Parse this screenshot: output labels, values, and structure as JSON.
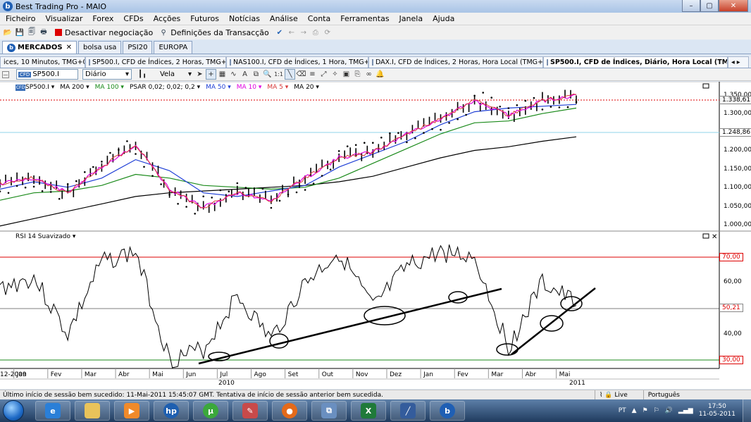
{
  "window": {
    "title": "Best Trading Pro - MAIO",
    "app_icon": "b"
  },
  "window_buttons": {
    "minimize": "–",
    "maximize": "▢",
    "close": "✕"
  },
  "menu": [
    "Ficheiro",
    "Visualizar",
    "Forex",
    "CFDs",
    "Acções",
    "Futuros",
    "Notícias",
    "Análise",
    "Conta",
    "Ferramentas",
    "Janela",
    "Ajuda"
  ],
  "toolbar": {
    "deactivate_label": "Desactivar negociação",
    "settings_label": "Definições da Transacção"
  },
  "market_tabs": [
    {
      "label": "MERCADOS",
      "active": true
    },
    {
      "label": "bolsa usa",
      "active": false
    },
    {
      "label": "PSI20",
      "active": false
    },
    {
      "label": "EUROPA",
      "active": false
    }
  ],
  "chart_tabs": [
    {
      "label": "ices, 10 Minutos, TMG+0",
      "active": false
    },
    {
      "label": "SP500.I, CFD de Índices, 2 Horas, TMG+0",
      "active": false
    },
    {
      "label": "NAS100.I, CFD de Índices, 1 Hora, TMG+0",
      "active": false
    },
    {
      "label": "DAX.I, CFD de Índices, 2 Horas, Hora Local (TMG+0)",
      "active": false
    },
    {
      "label": "SP500.I, CFD de Índices, Diário, Hora Local (TMG+0)",
      "active": true
    }
  ],
  "chart_toolbar": {
    "symbol": "SP500.I",
    "symbol_tag": "CFD",
    "period": "Diário",
    "chart_type": "Vela"
  },
  "indicators": [
    "SP500.I",
    "MA 200",
    "MA 100",
    "PSAR 0,02; 0,02; 0,2",
    "MA 50",
    "MA 10",
    "MA 5",
    "MA 20"
  ],
  "indicator_colors": {
    "MA 200": "#000000",
    "MA 100": "#1a8a1a",
    "MA 50": "#1f3fd6",
    "MA 10": "#e000e0",
    "MA 5": "#d83a3a",
    "MA 20": "#000000",
    "price": "#000000",
    "psar": "#000000"
  },
  "rsi_label": "RSI 14 Suavizado",
  "price_axis": {
    "ticks": [
      "1.350,00",
      "1.300,00",
      "1.250,00",
      "1.200,00",
      "1.150,00",
      "1.100,00",
      "1.050,00",
      "1.000,00"
    ],
    "current_price": "1.338,61",
    "cursor_price": "1.248,86"
  },
  "rsi_axis": {
    "ticks": [
      "60,00",
      "40,00"
    ],
    "overbought": "70,00",
    "oversold": "30,00",
    "current_value": "50,21"
  },
  "time_axis": {
    "start_label": "12-2009",
    "months": [
      "Jan",
      "Fev",
      "Mar",
      "Abr",
      "Mai",
      "Jun",
      "Jul",
      "Ago",
      "Set",
      "Out",
      "Nov",
      "Dez",
      "Jan",
      "Fev",
      "Mar",
      "Abr",
      "Mai"
    ],
    "years": [
      "2010",
      "2011"
    ]
  },
  "status": {
    "message": "Último início de sessão bem sucedido: 11-Mai-2011 15:45:07 GMT. Tentativa de início de sessão anterior bem sucedida.",
    "connection": "Live",
    "language": "Português"
  },
  "taskbar": {
    "apps": [
      "ie-icon",
      "explorer-icon",
      "media-player-icon",
      "hp-icon",
      "utorrent-icon",
      "paint-icon",
      "firefox-icon",
      "network-icon",
      "excel-icon",
      "chart-icon",
      "best-trading-icon"
    ],
    "locale": "PT",
    "time": "17:50",
    "date": "11-05-2011"
  },
  "chart_data": {
    "type": "line",
    "x": [
      "Dez 2009",
      "Jan 2010",
      "Fev 2010",
      "Mar 2010",
      "Abr 2010",
      "Mai 2010",
      "Jun 2010",
      "Jul 2010",
      "Ago 2010",
      "Set 2010",
      "Out 2010",
      "Nov 2010",
      "Dez 2010",
      "Jan 2011",
      "Fev 2011",
      "Mar 2011",
      "Abr 2011",
      "Mai 2011"
    ],
    "series": [
      {
        "name": "SP500.I",
        "values": [
          1105,
          1120,
          1080,
          1150,
          1210,
          1090,
          1040,
          1080,
          1060,
          1120,
          1175,
          1190,
          1240,
          1280,
          1330,
          1290,
          1330,
          1345
        ]
      },
      {
        "name": "MA 200",
        "values": [
          990,
          1010,
          1030,
          1050,
          1070,
          1080,
          1085,
          1090,
          1095,
          1100,
          1110,
          1125,
          1150,
          1175,
          1195,
          1205,
          1220,
          1232
        ]
      },
      {
        "name": "MA 100",
        "values": [
          1060,
          1080,
          1085,
          1100,
          1130,
          1120,
          1100,
          1095,
          1090,
          1095,
          1120,
          1160,
          1200,
          1240,
          1270,
          1275,
          1295,
          1310
        ]
      },
      {
        "name": "MA 50",
        "values": [
          1090,
          1110,
          1095,
          1120,
          1170,
          1140,
          1080,
          1070,
          1085,
          1100,
          1150,
          1185,
          1220,
          1265,
          1300,
          1310,
          1315,
          1320
        ]
      }
    ],
    "rsi": [
      58,
      62,
      40,
      68,
      72,
      30,
      34,
      55,
      38,
      60,
      72,
      50,
      66,
      72,
      70,
      35,
      60,
      52
    ],
    "ylim": [
      980,
      1370
    ],
    "rsi_levels": [
      30,
      70
    ]
  }
}
